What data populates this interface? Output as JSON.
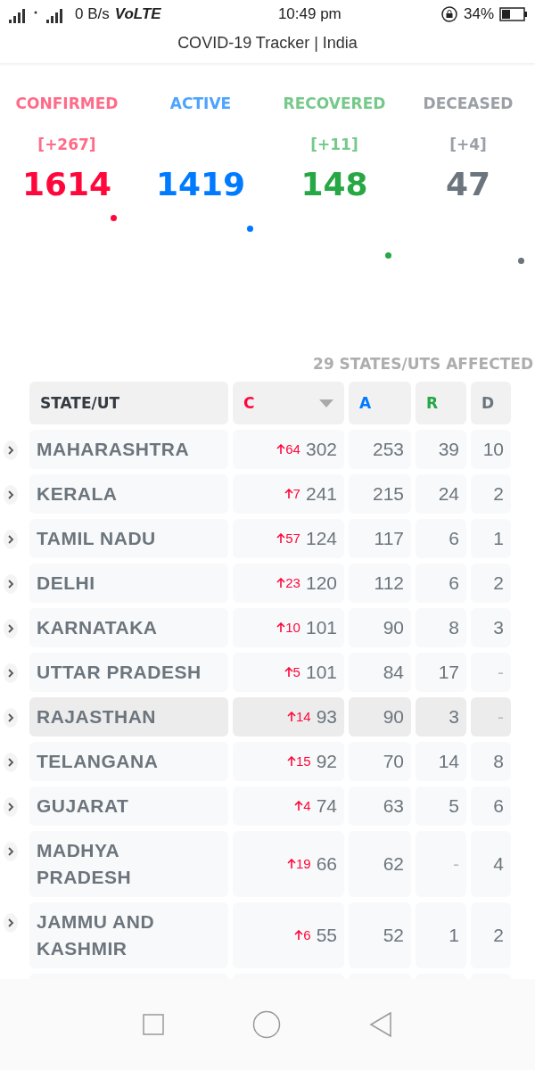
{
  "status_bar": {
    "network_speed": "0 B/s",
    "volte": "VoLTE",
    "time": "10:49 pm",
    "battery": "34%"
  },
  "app_bar": {
    "title": "COVID-19 Tracker | India"
  },
  "stats": [
    {
      "kind": "confirmed",
      "label": "CONFIRMED",
      "delta": "[+267]",
      "value": "1614"
    },
    {
      "kind": "active",
      "label": "ACTIVE",
      "value": "1419"
    },
    {
      "kind": "recovered",
      "label": "RECOVERED",
      "delta": "[+11]",
      "value": "148"
    },
    {
      "kind": "deceased",
      "label": "DECEASED",
      "delta": "[+4]",
      "value": "47"
    }
  ],
  "affected": "29 STATES/UTS AFFECTED",
  "table": {
    "columns": [
      {
        "kind": "state",
        "label": "STATE/UT",
        "sorted": false
      },
      {
        "kind": "confirmed",
        "label": "C",
        "sorted": true
      },
      {
        "kind": "active",
        "label": "A",
        "sorted": false
      },
      {
        "kind": "recovered",
        "label": "R",
        "sorted": false
      },
      {
        "kind": "deceased",
        "label": "D",
        "sorted": false
      }
    ],
    "rows": [
      {
        "state": "MAHARASHTRA",
        "delta": "64",
        "confirmed": "302",
        "active": "253",
        "recovered": "39",
        "deceased": "10",
        "selected": false
      },
      {
        "state": "KERALA",
        "delta": "7",
        "confirmed": "241",
        "active": "215",
        "recovered": "24",
        "deceased": "2",
        "selected": false
      },
      {
        "state": "TAMIL NADU",
        "delta": "57",
        "confirmed": "124",
        "active": "117",
        "recovered": "6",
        "deceased": "1",
        "selected": false
      },
      {
        "state": "DELHI",
        "delta": "23",
        "confirmed": "120",
        "active": "112",
        "recovered": "6",
        "deceased": "2",
        "selected": false
      },
      {
        "state": "KARNATAKA",
        "delta": "10",
        "confirmed": "101",
        "active": "90",
        "recovered": "8",
        "deceased": "3",
        "selected": false
      },
      {
        "state": "UTTAR PRADESH",
        "delta": "5",
        "confirmed": "101",
        "active": "84",
        "recovered": "17",
        "deceased": "-",
        "selected": false
      },
      {
        "state": "RAJASTHAN",
        "delta": "14",
        "confirmed": "93",
        "active": "90",
        "recovered": "3",
        "deceased": "-",
        "selected": true
      },
      {
        "state": "TELANGANA",
        "delta": "15",
        "confirmed": "92",
        "active": "70",
        "recovered": "14",
        "deceased": "8",
        "selected": false
      },
      {
        "state": "GUJARAT",
        "delta": "4",
        "confirmed": "74",
        "active": "63",
        "recovered": "5",
        "deceased": "6",
        "selected": false
      },
      {
        "state": "MADHYA PRADESH",
        "delta": "19",
        "confirmed": "66",
        "active": "62",
        "recovered": "-",
        "deceased": "4",
        "selected": false
      },
      {
        "state": "JAMMU AND KASHMIR",
        "delta": "6",
        "confirmed": "55",
        "active": "52",
        "recovered": "1",
        "deceased": "2",
        "selected": false
      }
    ]
  }
}
